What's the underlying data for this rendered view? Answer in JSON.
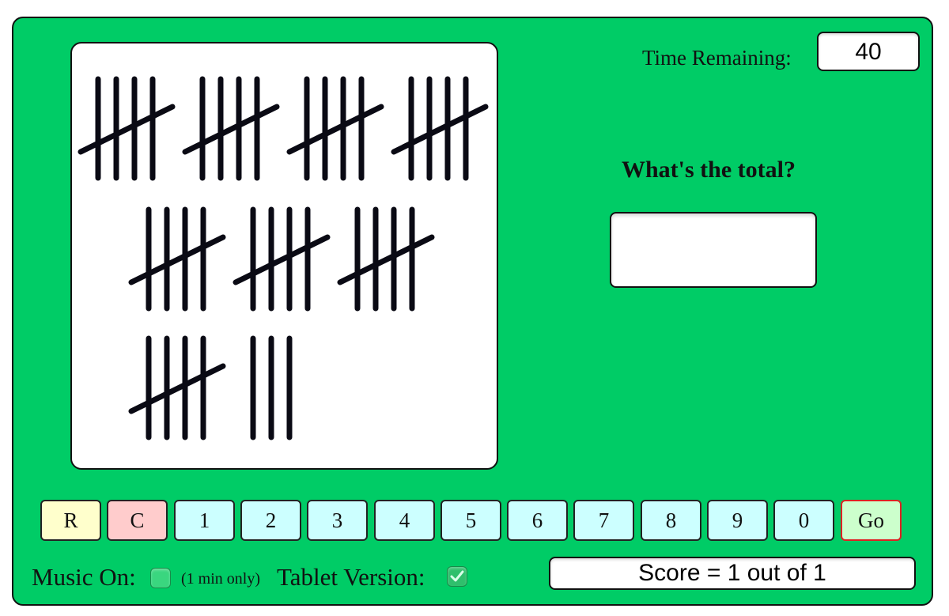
{
  "timer": {
    "label": "Time Remaining:",
    "value": "40"
  },
  "question": {
    "text": "What's the total?",
    "answer_value": "",
    "answer_placeholder": ""
  },
  "tally": {
    "rows": [
      [
        5,
        5,
        5,
        5
      ],
      [
        5,
        5,
        5
      ],
      [
        5,
        3
      ]
    ],
    "total": 43
  },
  "keypad": {
    "keys": [
      {
        "label": "R",
        "kind": "r"
      },
      {
        "label": "C",
        "kind": "c"
      },
      {
        "label": "1",
        "kind": "digit"
      },
      {
        "label": "2",
        "kind": "digit"
      },
      {
        "label": "3",
        "kind": "digit"
      },
      {
        "label": "4",
        "kind": "digit"
      },
      {
        "label": "5",
        "kind": "digit"
      },
      {
        "label": "6",
        "kind": "digit"
      },
      {
        "label": "7",
        "kind": "digit"
      },
      {
        "label": "8",
        "kind": "digit"
      },
      {
        "label": "9",
        "kind": "digit"
      },
      {
        "label": "0",
        "kind": "digit"
      },
      {
        "label": "Go",
        "kind": "go"
      }
    ]
  },
  "options": {
    "music_label": "Music On:",
    "music_checked": false,
    "music_note": "(1 min only)",
    "tablet_label": "Tablet Version:",
    "tablet_checked": true
  },
  "score": {
    "text": "Score = 1 out of 1",
    "correct": 1,
    "total": 1
  },
  "colors": {
    "panel": "#00cc66",
    "digit_key": "#ccffff",
    "reset_key": "#ffffcc",
    "clear_key": "#ffcccc",
    "go_key": "#ccffcc",
    "go_border": "#dd2222"
  }
}
